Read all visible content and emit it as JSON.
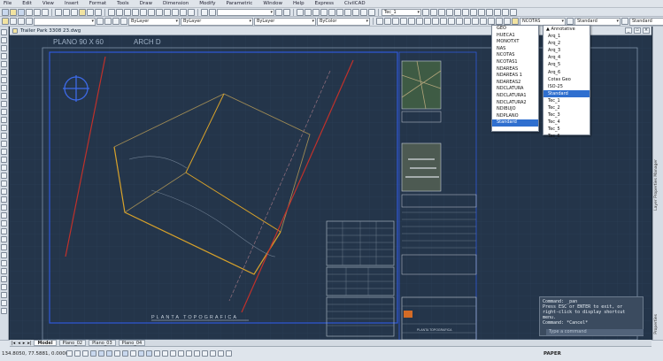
{
  "menu": [
    "File",
    "Edit",
    "View",
    "Insert",
    "Format",
    "Tools",
    "Draw",
    "Dimension",
    "Modify",
    "Parametric",
    "Window",
    "Help",
    "Express",
    "CivilCAD"
  ],
  "toolbar": {
    "layer_combo": "",
    "color_combo": "ByLayer",
    "linetype_combo": "ByLayer",
    "lineweight_combo": "ByLayer",
    "plot_combo": "ByColor",
    "text_style_combo": "Tec_1",
    "dim_style_combo": "Standard",
    "style_right": "Standard",
    "text_style_combo2": "NCOTAS"
  },
  "document": {
    "title": "Trailer Park 3308 23.dwg"
  },
  "drawing": {
    "heading": "PLANO 90 X 60",
    "heading2": "ARCH D",
    "bottom_title": "PLANTA TOPOGRAFICA",
    "block_title": "PLANTA TOPOGRAFICA"
  },
  "text_style_dropdown": {
    "items": [
      "GEO",
      "HUECA1",
      "MONOTXT",
      "NAS",
      "NCOTAS",
      "NCOTAS1",
      "NDAREAS",
      "NDAREAS 1",
      "NDAREAS2",
      "NDCLATURA",
      "NDCLATURA1",
      "NDCLATURA2",
      "NDIBUJO",
      "NDPLANO",
      "Standard"
    ],
    "selected": "Standard"
  },
  "dim_style_dropdown": {
    "items": [
      "Annotative",
      "Arq_1",
      "Arq_2",
      "Arq_3",
      "Arq_4",
      "Arq_5",
      "Arq_6",
      "Cotas Geo",
      "ISO-25",
      "Standard",
      "Tec_1",
      "Tec_2",
      "Tec_3",
      "Tec_4",
      "Tec_5",
      "Tec_6"
    ],
    "selected": "Standard"
  },
  "layout_tabs": [
    "Model",
    "Plano_02",
    "Plano_03",
    "Plano_04"
  ],
  "active_tab": "Model",
  "command_window": {
    "lines": [
      "Command: _pan",
      "Press ESC or ENTER to exit, or",
      "right-click to display shortcut",
      "menu.",
      "Command: *Cancel*"
    ],
    "placeholder": "Type a command"
  },
  "status": {
    "coordinates": "134.8050, 77.5881, 0.0000",
    "paper": "PAPER"
  },
  "right_panel": {
    "label": "Layer Properties Manager",
    "label2": "Properties"
  },
  "colors": {
    "canvas": "#24354a",
    "frame": "#2f59d9",
    "property_line": "#d8a22a",
    "road_line": "#c0312b"
  }
}
